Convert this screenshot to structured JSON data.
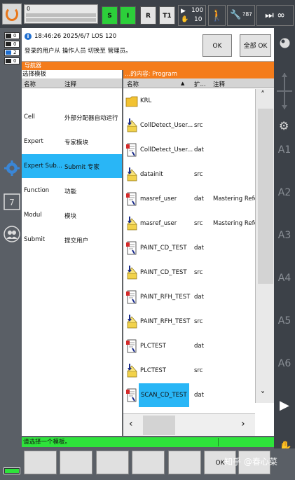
{
  "topbar": {
    "progress_value": "0",
    "btn_s": "S",
    "btn_i": "I",
    "btn_r": "R",
    "btn_t1": "T1",
    "override_top": "100",
    "override_bottom": "10",
    "tool_text": "?8?",
    "infinity": "∞"
  },
  "indicators": [
    "0",
    "0",
    "2",
    "0"
  ],
  "message": {
    "header": "18:46:26 2025/6/7 LOS 120",
    "body": "登录的用户从 操作人员 切换至 管理员。",
    "ok_label": "OK",
    "all_ok_label": "全部 OK"
  },
  "navigator": {
    "title": "导航器",
    "left_title": "选择模板",
    "right_title": "...的内容: Program",
    "left_columns": [
      "名称",
      "注释"
    ],
    "right_columns": [
      "名称",
      "扩...",
      "注释"
    ],
    "modules": [
      {
        "name": "Cell",
        "comment": "外部分配器自动运行"
      },
      {
        "name": "Expert",
        "comment": "专家模块"
      },
      {
        "name": "Expert Sub...",
        "comment": "Submit 专家"
      },
      {
        "name": "Function",
        "comment": "功能"
      },
      {
        "name": "Modul",
        "comment": "模块"
      },
      {
        "name": "Submit",
        "comment": "提交用户"
      }
    ],
    "files": [
      {
        "name": "KRL",
        "ext": "",
        "comment": ""
      },
      {
        "name": "CollDetect_User...",
        "ext": "src",
        "comment": ""
      },
      {
        "name": "CollDetect_User...",
        "ext": "dat",
        "comment": ""
      },
      {
        "name": "datainit",
        "ext": "src",
        "comment": ""
      },
      {
        "name": "masref_user",
        "ext": "dat",
        "comment": "Mastering Refer"
      },
      {
        "name": "masref_user",
        "ext": "src",
        "comment": "Mastering Refer"
      },
      {
        "name": "PAINT_CD_TEST",
        "ext": "dat",
        "comment": ""
      },
      {
        "name": "PAINT_CD_TEST",
        "ext": "src",
        "comment": ""
      },
      {
        "name": "PAINT_RFH_TEST",
        "ext": "dat",
        "comment": ""
      },
      {
        "name": "PAINT_RFH_TEST",
        "ext": "src",
        "comment": ""
      },
      {
        "name": "PLCTEST",
        "ext": "dat",
        "comment": ""
      },
      {
        "name": "PLCTEST",
        "ext": "src",
        "comment": ""
      },
      {
        "name": "SCAN_CD_TEST",
        "ext": "dat",
        "comment": ""
      }
    ]
  },
  "rightrail": {
    "axes": [
      "A1",
      "A2",
      "A3",
      "A4",
      "A5",
      "A6"
    ]
  },
  "status": {
    "text": "请选择一个模板。"
  },
  "bottom": {
    "ok_label": "OK",
    "watermark": "知乎 @春心菜"
  }
}
